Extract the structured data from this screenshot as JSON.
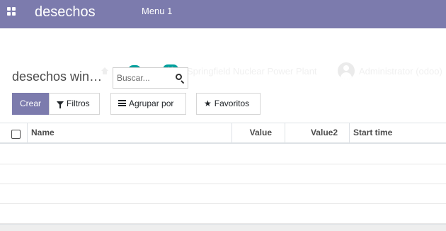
{
  "navbar": {
    "app_title": "desechos",
    "menu": [
      "Menu 1"
    ],
    "color": "#7c7bad"
  },
  "systray": {
    "chat_badge": "1",
    "activity_badge": "12",
    "company": "Springfield Nuclear Power Plant",
    "user": "Administrator (odoo)",
    "badge_color": "#00a09d"
  },
  "control_panel": {
    "breadcrumb": "desechos win…",
    "search_placeholder": "Buscar...",
    "create_label": "Crear",
    "filters_label": "Filtros",
    "group_by_label": "Agrupar por",
    "favorites_label": "Favoritos"
  },
  "table": {
    "columns": [
      "Name",
      "Value",
      "Value2",
      "Start time"
    ],
    "rows": []
  },
  "icons": {
    "apps": "apps-grid-icon",
    "home": "home-icon",
    "chat": "chat-icon",
    "activity": "clock-icon",
    "search": "search-icon",
    "filter": "filter-icon",
    "group": "bars-icon",
    "favorite": "star-icon"
  }
}
